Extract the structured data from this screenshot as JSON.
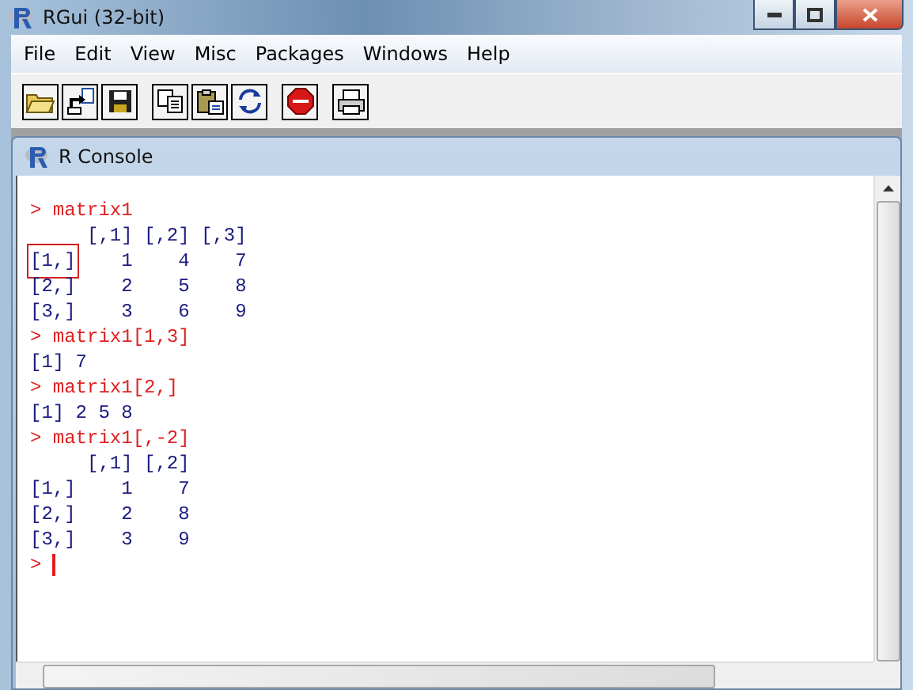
{
  "window": {
    "title": "RGui (32-bit)"
  },
  "menu": [
    "File",
    "Edit",
    "View",
    "Misc",
    "Packages",
    "Windows",
    "Help"
  ],
  "toolbar": [
    {
      "kind": "open"
    },
    {
      "kind": "load"
    },
    {
      "kind": "save"
    },
    {
      "kind": "copy"
    },
    {
      "kind": "paste"
    },
    {
      "kind": "refresh"
    },
    {
      "kind": "stop"
    },
    {
      "kind": "print"
    }
  ],
  "console": {
    "title": "R Console",
    "lines": [
      {
        "kind": "input",
        "prompt": ">",
        "text": "matrix1"
      },
      {
        "kind": "output",
        "text": "     [,1] [,2] [,3]"
      },
      {
        "kind": "output",
        "boxed": "[1,]",
        "text": "    1    4    7"
      },
      {
        "kind": "output",
        "text": "[2,]    2    5    8"
      },
      {
        "kind": "output",
        "text": "[3,]    3    6    9"
      },
      {
        "kind": "input",
        "prompt": ">",
        "text": "matrix1[1,3]"
      },
      {
        "kind": "output",
        "text": "[1] 7"
      },
      {
        "kind": "input",
        "prompt": ">",
        "text": "matrix1[2,]"
      },
      {
        "kind": "output",
        "text": "[1] 2 5 8"
      },
      {
        "kind": "input",
        "prompt": ">",
        "text": "matrix1[,-2]"
      },
      {
        "kind": "output",
        "text": "     [,1] [,2]"
      },
      {
        "kind": "output",
        "text": "[1,]    1    7"
      },
      {
        "kind": "output",
        "text": "[2,]    2    8"
      },
      {
        "kind": "output",
        "text": "[3,]    3    9"
      },
      {
        "kind": "cursor",
        "prompt": ">"
      }
    ]
  }
}
